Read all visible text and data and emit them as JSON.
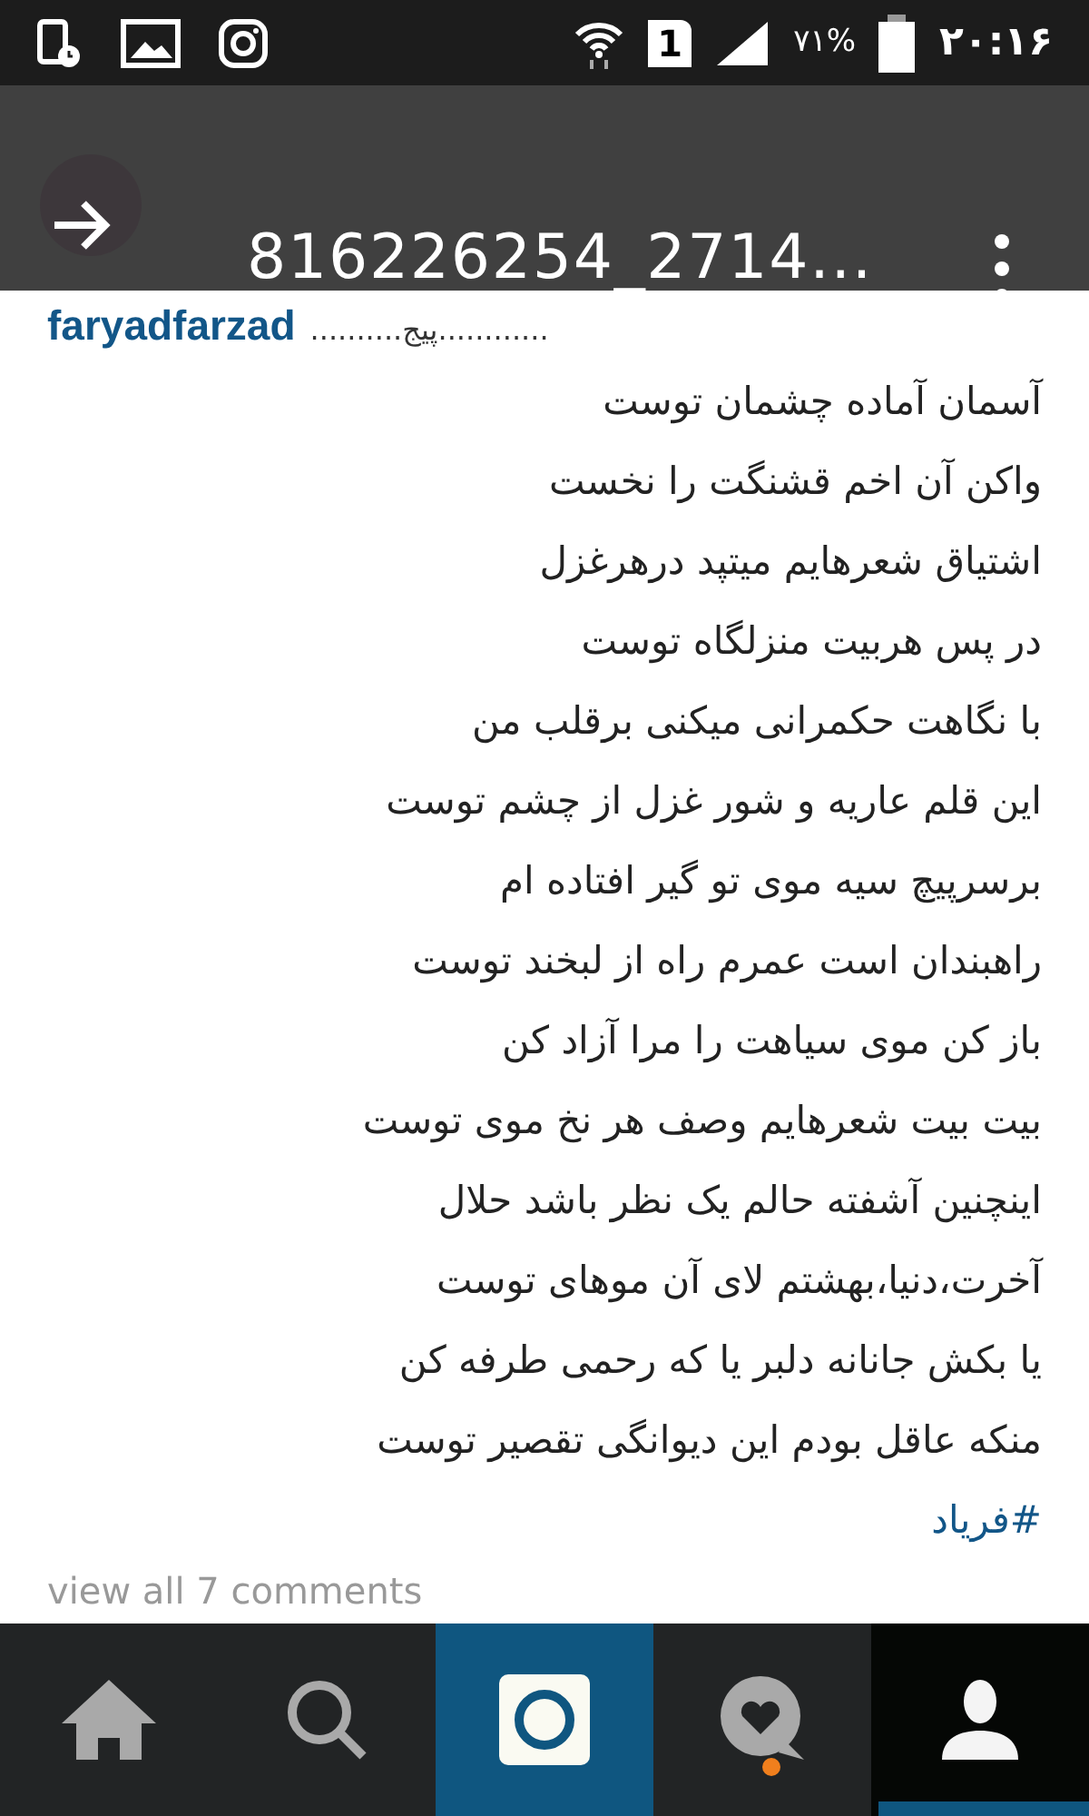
{
  "status_bar": {
    "battery": "۷۱%",
    "sim": "1",
    "time": "۲۰:۱۶"
  },
  "header": {
    "title": "816226254_2714..."
  },
  "caption": {
    "author": "faryadfarzad",
    "text": "..........پیج............"
  },
  "poem": [
    "آسمان آماده چشمان توست",
    "واکن آن اخم قشنگت را نخست",
    "اشتیاق شعرهایم میتپد درهرغزل",
    "در پس هربیت منزلگاه توست",
    "با نگاهت حکمرانی میکنی برقلب من",
    "این قلم عاریه و شور غزل از چشم توست",
    "برسرپیچ سیه موی تو گیر افتاده ام",
    "راهبندان است عمرم راه از لبخند توست",
    "باز کن موی سیاهت را مرا آزاد کن",
    "بیت بیت شعرهایم وصف هر نخ موی توست",
    "اینچنین آشفته حالم یک نظر باشد حلال",
    "آخرت،دنیا،بهشتم لای آن موهای توست",
    "یا بکش جانانه دلبر یا که رحمی طرفه کن",
    "منکه عاقل بودم این دیوانگی تقصیر توست"
  ],
  "hashtag": "#فریاد",
  "comments_link": "view all 7 comments",
  "nav": [
    {
      "kind": "home",
      "selected": false
    },
    {
      "kind": "search",
      "selected": false
    },
    {
      "kind": "camera",
      "selected": false
    },
    {
      "kind": "activity",
      "selected": false,
      "color": "#f07f1d"
    },
    {
      "kind": "profile",
      "selected": true
    }
  ]
}
